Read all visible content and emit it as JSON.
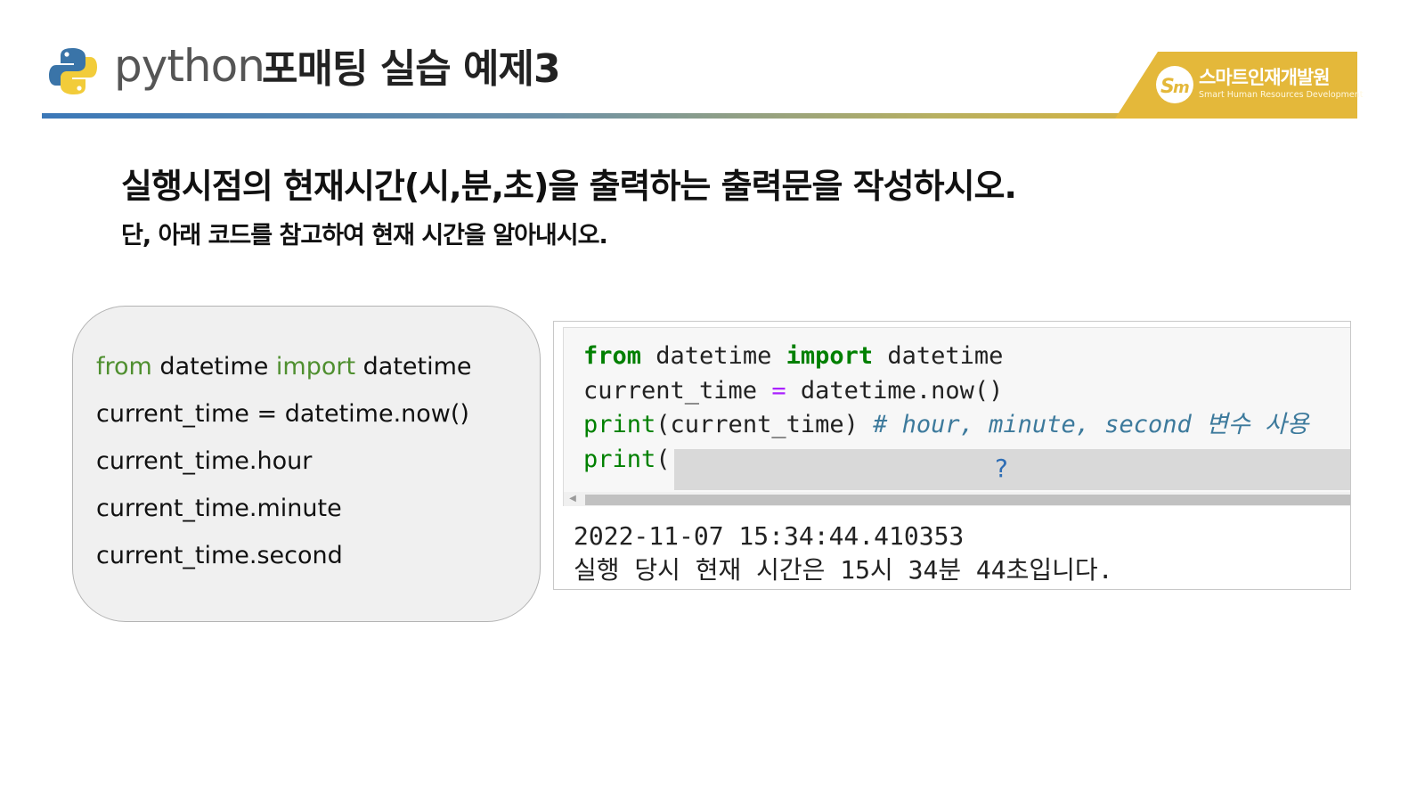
{
  "header": {
    "brand_word": "python",
    "title": "포매팅 실습 예제3",
    "logo_icon": "python-logo-icon"
  },
  "badge": {
    "name": "스마트인재개발원",
    "subtitle": "Smart Human Resources Development",
    "color": "#e4b83a",
    "icon": "smhrd-logo-icon"
  },
  "question": {
    "main": "실행시점의 현재시간(시,분,초)을 출력하는 출력문을 작성하시오.",
    "sub": "단, 아래 코드를 참고하여 현재 시간을 알아내시오."
  },
  "reference": {
    "line1": {
      "kw1": "from",
      "mod": " datetime ",
      "kw2": "import",
      "name": " datetime"
    },
    "lines": [
      "current_time = datetime.now()",
      "current_time.hour",
      "current_time.minute",
      "current_time.second"
    ]
  },
  "notebook": {
    "code": {
      "line1": {
        "kw1": "from",
        "mid": " datetime ",
        "kw2": "import",
        "end": " datetime"
      },
      "line2": {
        "a": "current_time ",
        "op": "=",
        "b": " datetime.now()"
      },
      "line3": {
        "fn": "print",
        "args": "(current_time) ",
        "comment": "# hour, minute, second 변수 사용"
      },
      "line4": {
        "fn": "print",
        "paren": "("
      },
      "blank_placeholder": "?"
    },
    "output": [
      "2022-11-07 15:34:44.410353",
      "실행 당시 현재 시간은 15시 34분 44초입니다."
    ]
  }
}
